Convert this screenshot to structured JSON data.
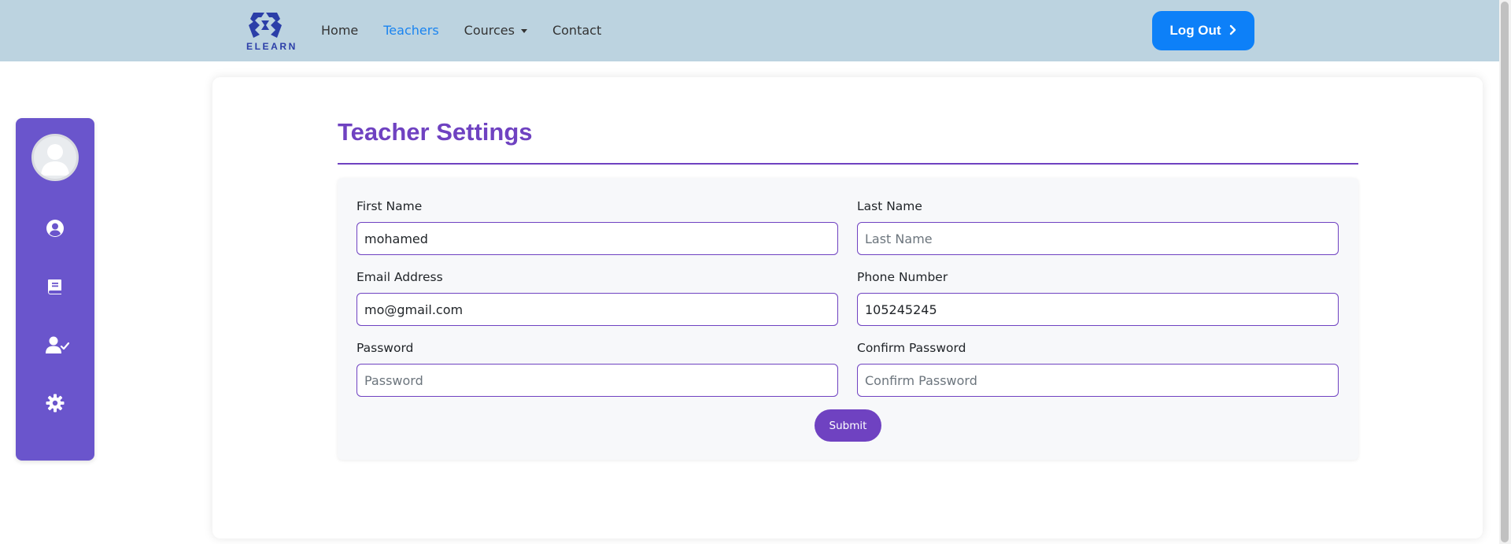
{
  "brand": {
    "logo_text": "ELEARN",
    "logo_color": "#2b3ea8"
  },
  "nav": {
    "links": [
      {
        "label": "Home",
        "active": false
      },
      {
        "label": "Teachers",
        "active": true
      },
      {
        "label": "Cources",
        "dropdown": true
      },
      {
        "label": "Contact",
        "active": false
      }
    ],
    "logout_label": "Log Out",
    "logout_icon": "chevron-right-icon"
  },
  "sidebar": {
    "icons": [
      "avatar",
      "user-circle-icon",
      "book-icon",
      "user-check-icon",
      "gear-icon"
    ]
  },
  "page": {
    "title": "Teacher Settings"
  },
  "form": {
    "first_name": {
      "label": "First Name",
      "value": "mohamed",
      "placeholder": ""
    },
    "last_name": {
      "label": "Last Name",
      "value": "",
      "placeholder": "Last Name"
    },
    "email": {
      "label": "Email Address",
      "value": "mo@gmail.com",
      "placeholder": ""
    },
    "phone": {
      "label": "Phone Number",
      "value": "105245245",
      "placeholder": ""
    },
    "password": {
      "label": "Password",
      "value": "",
      "placeholder": "Password"
    },
    "confirm_password": {
      "label": "Confirm Password",
      "value": "",
      "placeholder": "Confirm Password"
    },
    "submit_label": "Submit"
  },
  "colors": {
    "navbar_bg": "#bcd3e0",
    "accent": "#6f42c1",
    "sidebar_bg": "#6a55cc",
    "logout_bg": "#0d80f8",
    "active_link": "#1a84f0"
  }
}
